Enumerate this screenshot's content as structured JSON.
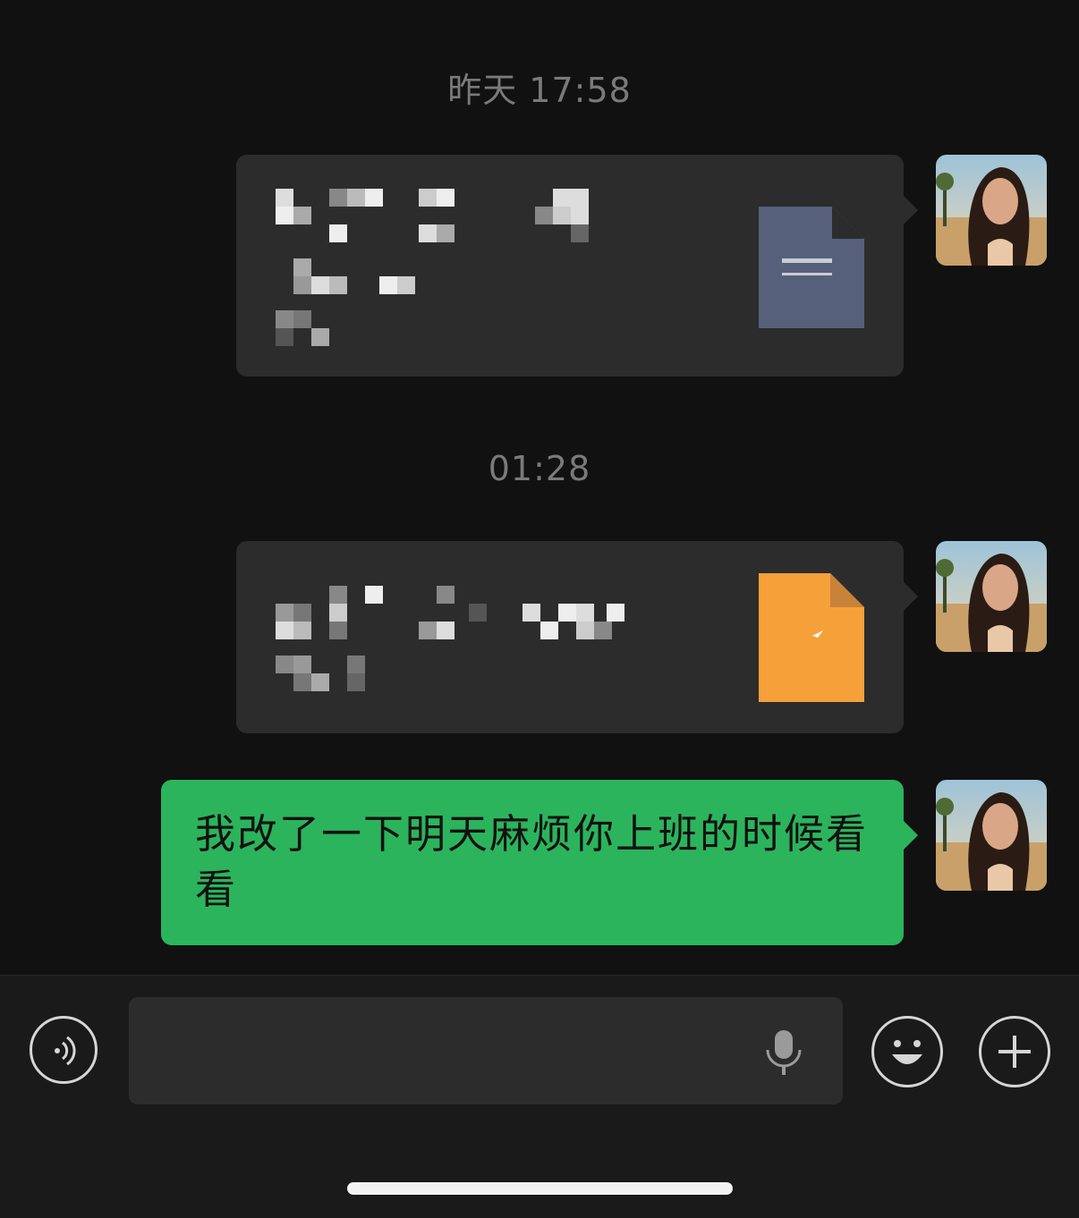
{
  "timestamps": [
    "昨天 17:58",
    "01:28"
  ],
  "messages": {
    "file1": {
      "type": "file",
      "icon": "document-file-icon",
      "icon_color": "#56607a"
    },
    "file2": {
      "type": "file",
      "icon": "document-file-icon",
      "icon_color": "#f6a03a"
    },
    "text1": {
      "type": "text",
      "text": "我改了一下明天麻烦你上班的时候看看",
      "bubble_color": "#2bb45c"
    }
  },
  "input_bar": {
    "left_button_icon": "voice-toggle-icon",
    "mic_icon": "microphone-icon",
    "emoji_button_icon": "emoji-icon",
    "plus_button_icon": "plus-icon",
    "input_value": ""
  },
  "colors": {
    "background": "#111111",
    "incoming_file_bubble": "#2c2c2c",
    "sent_text_bubble": "#2bb45c",
    "timestamp_text": "#7a7a7a"
  }
}
